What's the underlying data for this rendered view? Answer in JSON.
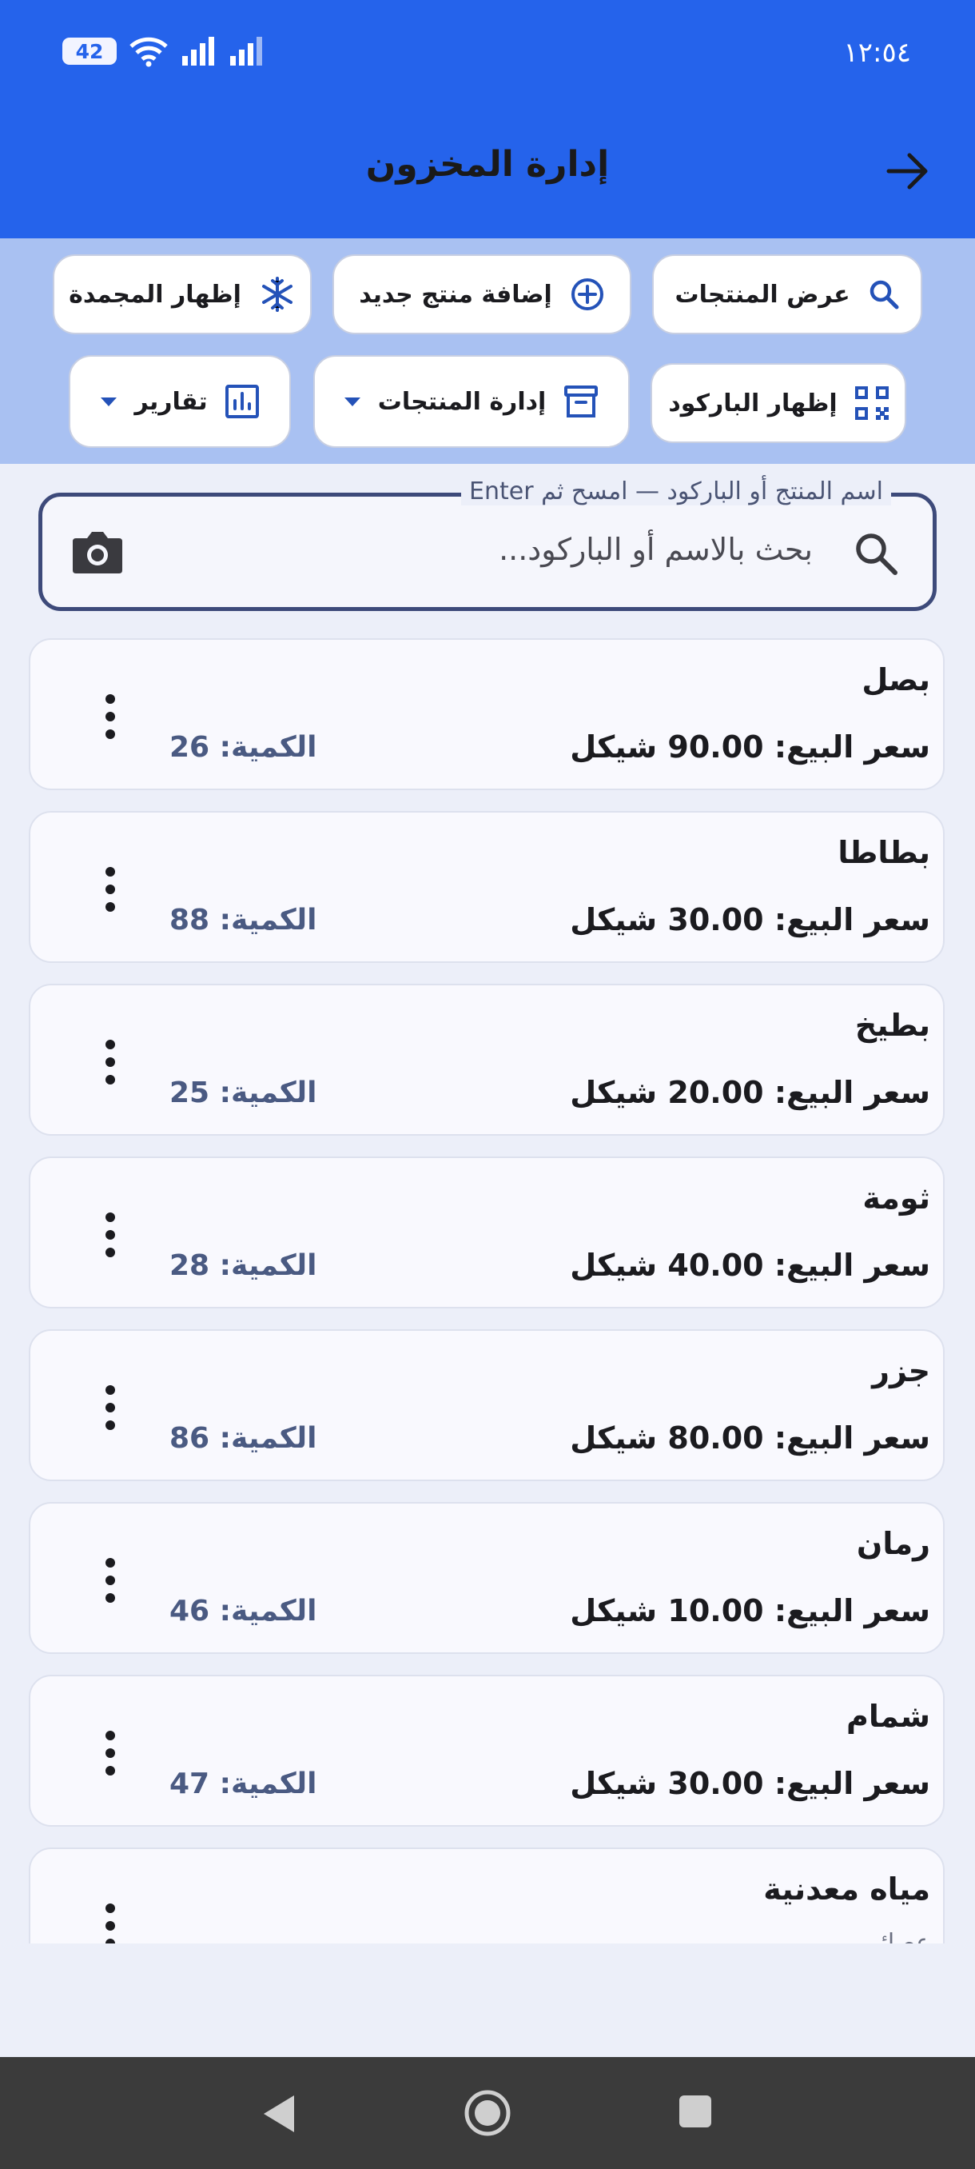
{
  "status_bar": {
    "time": "١٢:٥٤",
    "battery": "42"
  },
  "header": {
    "title": "إدارة المخزون"
  },
  "chips": {
    "view_products": "عرض المنتجات",
    "add_product": "إضافة منتج جديد",
    "show_frozen": "إظهار المجمدة",
    "show_barcode": "إظهار الباركود",
    "manage_products": "إدارة المنتجات",
    "reports": "تقارير"
  },
  "search": {
    "label": "اسم المنتج أو الباركود — امسح ثم Enter",
    "placeholder": "بحث بالاسم أو الباركود..."
  },
  "products": [
    {
      "name": "بصل",
      "price": "سعر البيع: 90.00 شيكل",
      "qty": "الكمية: 26"
    },
    {
      "name": "بطاطا",
      "price": "سعر البيع: 30.00 شيكل",
      "qty": "الكمية: 88"
    },
    {
      "name": "بطيخ",
      "price": "سعر البيع: 20.00 شيكل",
      "qty": "الكمية: 25"
    },
    {
      "name": "ثومة",
      "price": "سعر البيع: 40.00 شيكل",
      "qty": "الكمية: 28"
    },
    {
      "name": "جزر",
      "price": "سعر البيع: 80.00 شيكل",
      "qty": "الكمية: 86"
    },
    {
      "name": "رمان",
      "price": "سعر البيع: 10.00 شيكل",
      "qty": "الكمية: 46"
    },
    {
      "name": "شمام",
      "price": "سعر البيع: 30.00 شيكل",
      "qty": "الكمية: 47"
    },
    {
      "name": "مياه معدنية",
      "category": "عصائر"
    }
  ]
}
